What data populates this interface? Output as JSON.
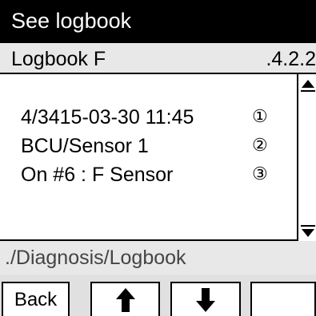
{
  "header": {
    "title": "See logbook"
  },
  "subheader": {
    "name": "Logbook F",
    "code": ".4.2.2"
  },
  "entries": [
    {
      "text": "4/3415-03-30 11:45",
      "marker": "①"
    },
    {
      "text": "BCU/Sensor 1",
      "marker": "②"
    },
    {
      "text": "On #6 : F Sensor",
      "marker": "③"
    }
  ],
  "path": "./Diagnosis/Logbook",
  "footer": {
    "back_label": "Back",
    "up_icon": "arrow-up-icon",
    "down_icon": "arrow-down-icon"
  }
}
